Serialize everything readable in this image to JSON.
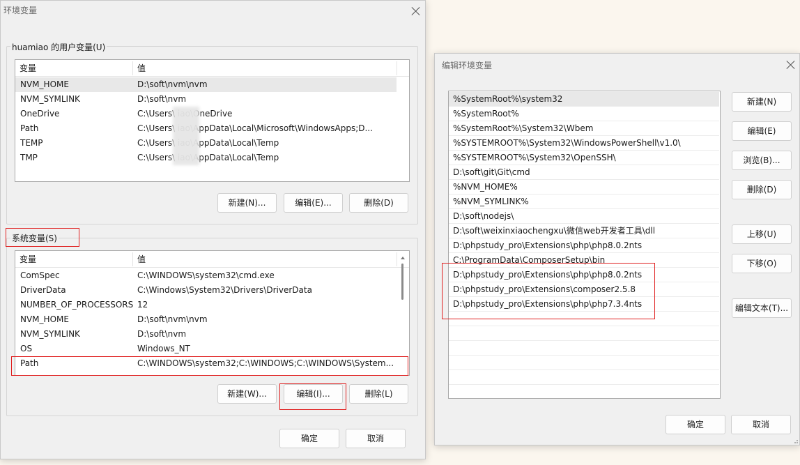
{
  "env_dialog": {
    "title": "环境变量",
    "user_group_label": "huamiao 的用户变量(U)",
    "user_vars": {
      "col_var": "变量",
      "col_val": "值",
      "rows": [
        {
          "name": "NVM_HOME",
          "value": "D:\\soft\\nvm\\nvm"
        },
        {
          "name": "NVM_SYMLINK",
          "value": "D:\\soft\\nvm"
        },
        {
          "name": "OneDrive",
          "value": "C:\\Users\\      iao\\OneDrive"
        },
        {
          "name": "Path",
          "value": "C:\\Users\\      iao\\AppData\\Local\\Microsoft\\WindowsApps;D..."
        },
        {
          "name": "TEMP",
          "value": "C:\\Users\\      iao\\AppData\\Local\\Temp"
        },
        {
          "name": "TMP",
          "value": "C:\\Users\\      iao\\AppData\\Local\\Temp"
        }
      ]
    },
    "user_buttons": {
      "new": "新建(N)...",
      "edit": "编辑(E)...",
      "delete": "删除(D)"
    },
    "system_group_label": "系统变量(S)",
    "system_vars": {
      "col_var": "变量",
      "col_val": "值",
      "rows": [
        {
          "name": "ComSpec",
          "value": "C:\\WINDOWS\\system32\\cmd.exe"
        },
        {
          "name": "DriverData",
          "value": "C:\\Windows\\System32\\Drivers\\DriverData"
        },
        {
          "name": "NUMBER_OF_PROCESSORS",
          "value": "12"
        },
        {
          "name": "NVM_HOME",
          "value": "D:\\soft\\nvm\\nvm"
        },
        {
          "name": "NVM_SYMLINK",
          "value": "D:\\soft\\nvm"
        },
        {
          "name": "OS",
          "value": "Windows_NT"
        },
        {
          "name": "Path",
          "value": "C:\\WINDOWS\\system32;C:\\WINDOWS;C:\\WINDOWS\\System..."
        }
      ]
    },
    "system_buttons": {
      "new": "新建(W)...",
      "edit": "编辑(I)...",
      "delete": "删除(L)"
    },
    "footer": {
      "ok": "确定",
      "cancel": "取消"
    }
  },
  "edit_dialog": {
    "title": "编辑环境变量",
    "paths": [
      "%SystemRoot%\\system32",
      "%SystemRoot%",
      "%SystemRoot%\\System32\\Wbem",
      "%SYSTEMROOT%\\System32\\WindowsPowerShell\\v1.0\\",
      "%SYSTEMROOT%\\System32\\OpenSSH\\",
      "D:\\soft\\git\\Git\\cmd",
      "%NVM_HOME%",
      "%NVM_SYMLINK%",
      "D:\\soft\\nodejs\\",
      "D:\\soft\\weixinxiaochengxu\\微信web开发者工具\\dll",
      "D:\\phpstudy_pro\\Extensions\\php\\php8.0.2nts",
      "C:\\ProgramData\\ComposerSetup\\bin",
      "D:\\phpstudy_pro\\Extensions\\php\\php8.0.2nts",
      "D:\\phpstudy_pro\\Extensions\\composer2.5.8",
      "D:\\phpstudy_pro\\Extensions\\php\\php7.3.4nts"
    ],
    "buttons": {
      "new": "新建(N)",
      "edit": "编辑(E)",
      "browse": "浏览(B)...",
      "delete": "删除(D)",
      "move_up": "上移(U)",
      "move_down": "下移(O)",
      "edit_text": "编辑文本(T)..."
    },
    "footer": {
      "ok": "确定",
      "cancel": "取消"
    }
  },
  "colors": {
    "highlight_box": "#e02020",
    "dialog_bg": "#f0f0f0",
    "desktop_bg": "#fbf6ee"
  }
}
